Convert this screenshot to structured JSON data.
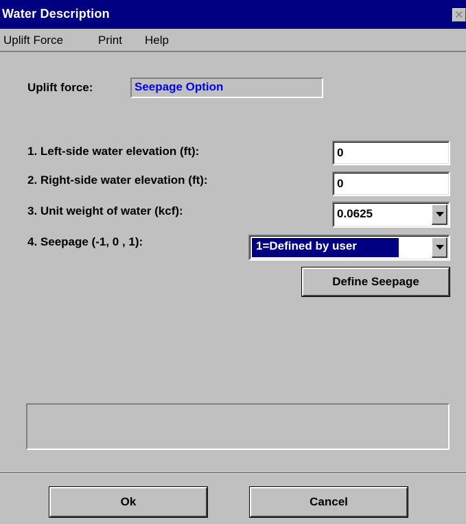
{
  "window": {
    "title": "Water Description",
    "close_glyph": "✕"
  },
  "menubar": {
    "items": [
      "Uplift Force",
      "Print",
      "Help"
    ]
  },
  "uplift": {
    "label": "Uplift force:",
    "value": "Seepage Option"
  },
  "fields": [
    {
      "label": "1. Left-side water elevation (ft):",
      "value": "0"
    },
    {
      "label": "2. Right-side water elevation (ft):",
      "value": "0"
    },
    {
      "label": "3. Unit weight of water (kcf):",
      "value": "0.0625"
    },
    {
      "label": "4. Seepage (-1, 0 , 1):",
      "value": "1=Defined by user"
    }
  ],
  "buttons": {
    "define_seepage": "Define Seepage",
    "ok": "Ok",
    "cancel": "Cancel"
  },
  "status": {
    "text": ""
  },
  "colors": {
    "titlebar": "#000080",
    "face": "#c0c0c0",
    "selection": "#000080",
    "uplift_text": "#0000ff"
  },
  "icons": {
    "close": "close-icon",
    "dropdown": "chevron-down-icon"
  }
}
